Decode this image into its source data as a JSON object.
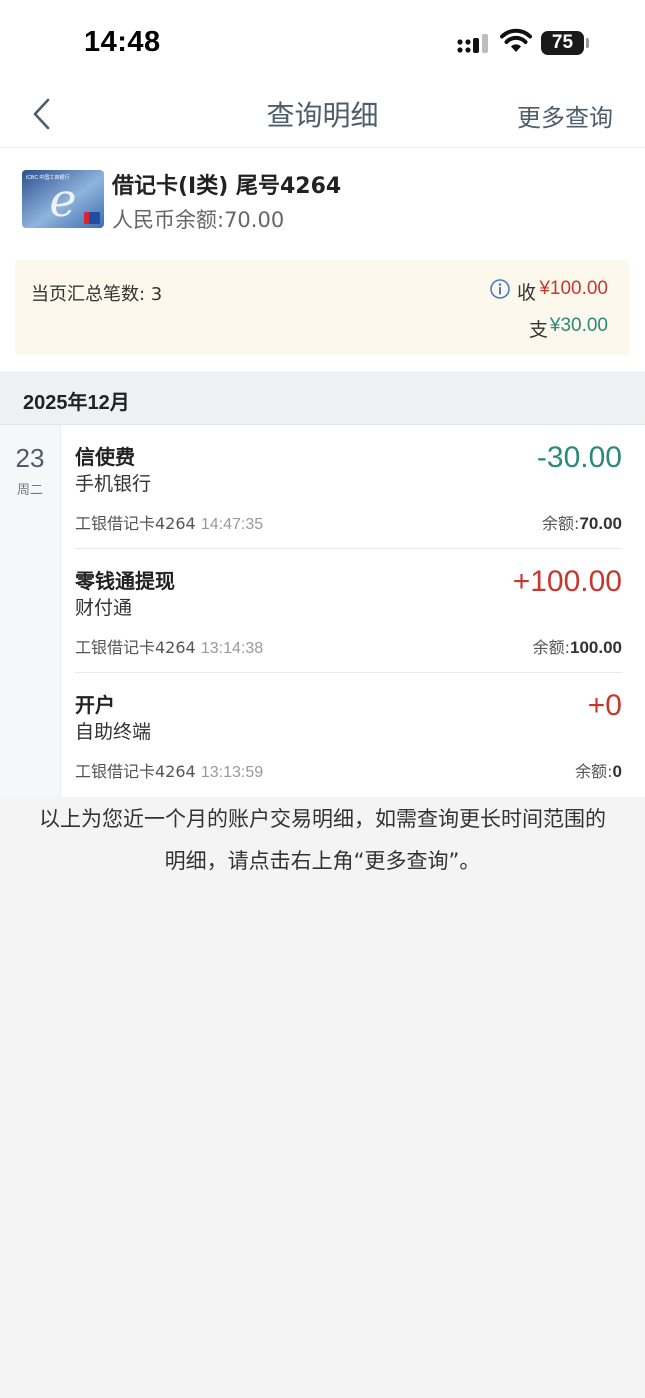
{
  "status_bar": {
    "time": "14:48",
    "battery": "75"
  },
  "nav": {
    "title": "查询明细",
    "more": "更多查询"
  },
  "card": {
    "name": "借记卡(Ⅰ类) 尾号4264",
    "balance": "人民币余额:70.00",
    "logo_text": "ICBC 中国工商银行"
  },
  "summary": {
    "count": "当页汇总笔数: 3",
    "income_label": "收",
    "income_amount": "¥100.00",
    "expense_label": "支",
    "expense_amount": "¥30.00"
  },
  "month": "2025年12月",
  "day": {
    "date": "23",
    "weekday": "周二"
  },
  "transactions": [
    {
      "title": "信使费",
      "channel": "手机银行",
      "amount": "-30.00",
      "card": "工银借记卡4264",
      "time": "14:47:35",
      "balance_label": "余额:",
      "balance": "70.00"
    },
    {
      "title": "零钱通提现",
      "channel": "财付通",
      "amount": "+100.00",
      "card": "工银借记卡4264",
      "time": "13:14:38",
      "balance_label": "余额:",
      "balance": "100.00"
    },
    {
      "title": "开户",
      "channel": "自助终端",
      "amount": "+0",
      "card": "工银借记卡4264",
      "time": "13:13:59",
      "balance_label": "余额:",
      "balance": "0"
    }
  ],
  "footer": {
    "line1": "以上为您近一个月的账户交易明细，如需查询更长时间范围的",
    "line2": "明细，请点击右上角“更多查询”。"
  },
  "colors": {
    "income": "#c8372f",
    "expense": "#2a8a7a",
    "summary_bg": "#fdf8ec"
  }
}
